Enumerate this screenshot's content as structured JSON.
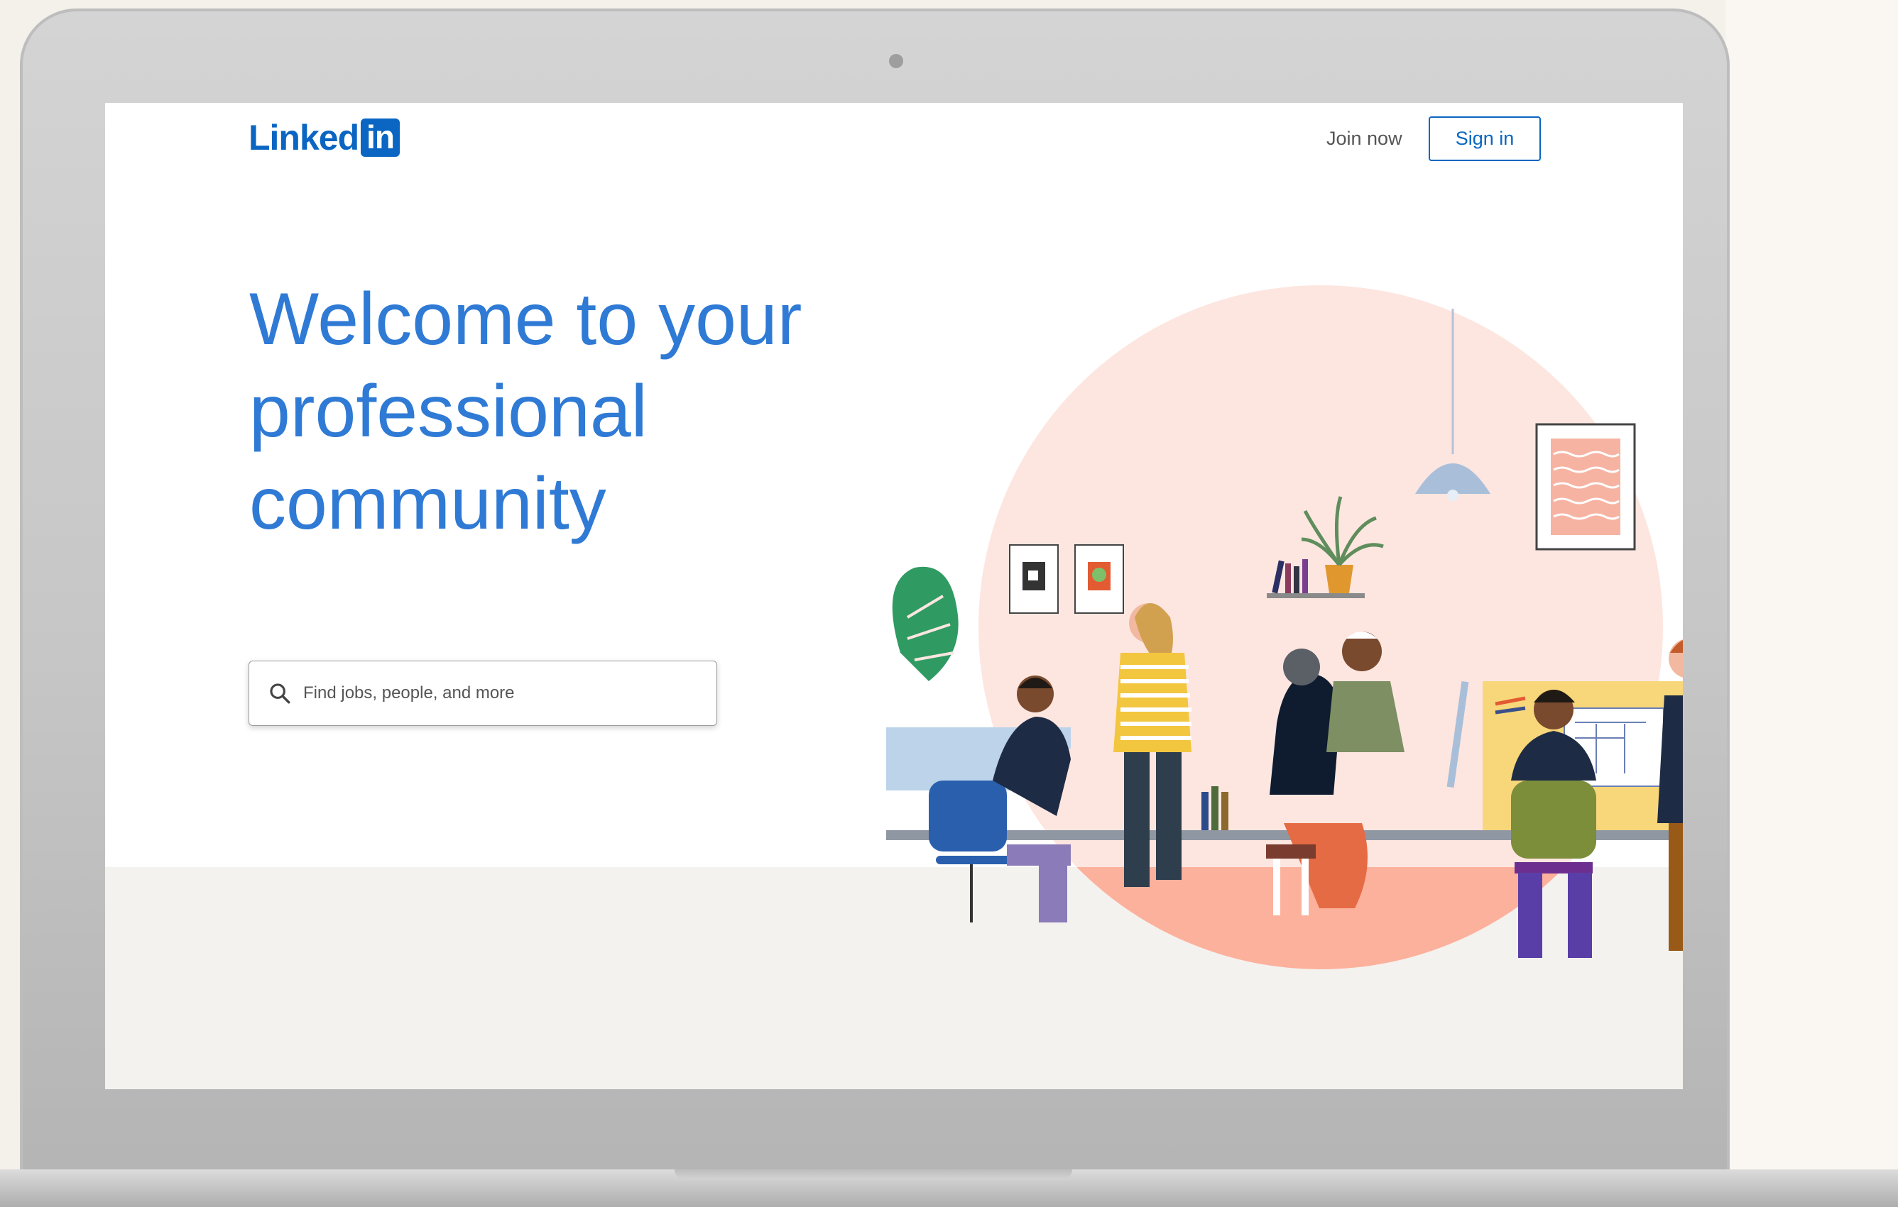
{
  "header": {
    "logo_text": "Linked",
    "logo_box": "in",
    "join_label": "Join now",
    "signin_label": "Sign in"
  },
  "hero": {
    "headline_line1": "Welcome to your",
    "headline_line2": "professional",
    "headline_line3": "community"
  },
  "search": {
    "placeholder": "Find jobs, people, and more",
    "icon": "search-icon"
  },
  "colors": {
    "brand": "#0a66c2",
    "headline": "#2f7ad5",
    "circle": "#fde6e0",
    "floor": "#fcb19c"
  }
}
